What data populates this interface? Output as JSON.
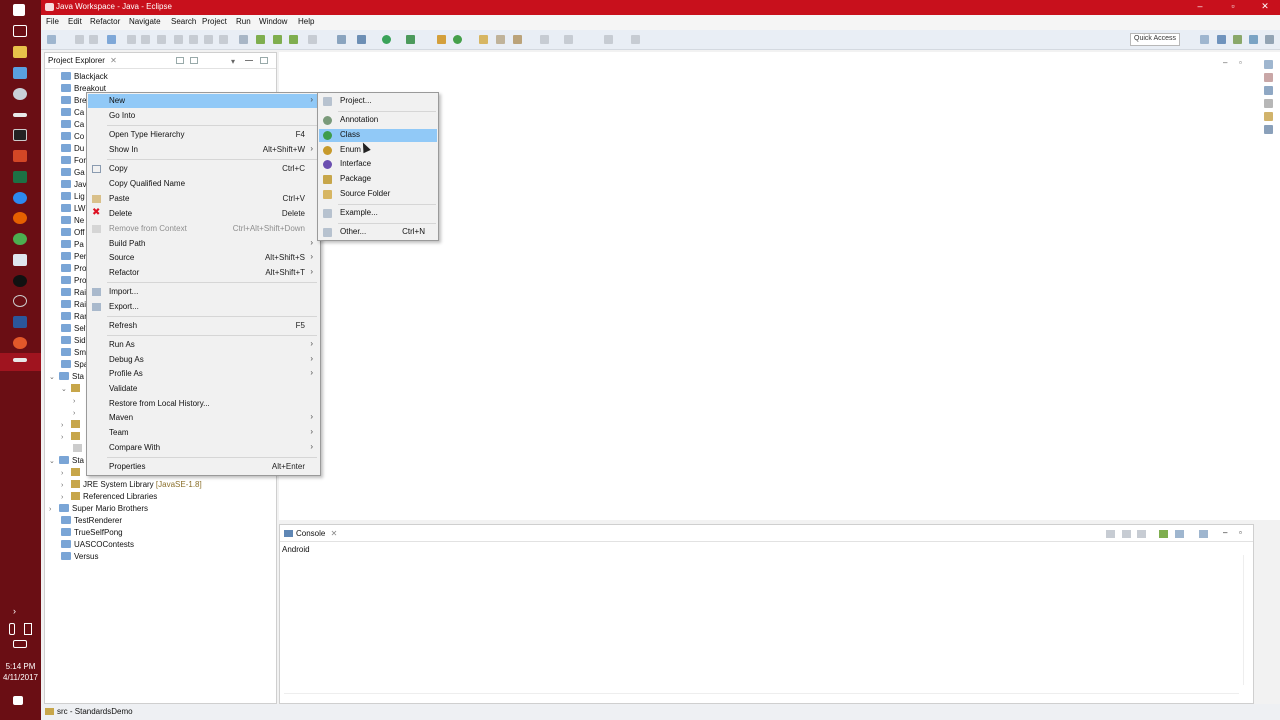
{
  "window": {
    "title": "Java Workspace - Java - Eclipse"
  },
  "menubar": [
    "File",
    "Edit",
    "Refactor",
    "Navigate",
    "Search",
    "Project",
    "Run",
    "Window",
    "Help"
  ],
  "toolbar": {
    "quick_access": "Quick Access"
  },
  "explorer": {
    "title": "Project Explorer",
    "rows": [
      "Blackjack",
      "Breakout",
      "Bre",
      "Ca",
      "Ca",
      "Co",
      "Du",
      "For",
      "Ga",
      "Jav",
      "Lig",
      "LW",
      "Ne",
      "Off",
      "Pa",
      "Per",
      "Pro",
      "Pro",
      "Rai",
      "Rai",
      "Ran",
      "Self",
      "Sid",
      "Sm",
      "Spa",
      "Sta",
      "",
      "",
      "",
      "",
      "",
      "Sta",
      "",
      "JRE System Library",
      "Referenced Libraries",
      "Super Mario Brothers",
      "TestRenderer",
      "TrueSelfPong",
      "UASCOContests",
      "Versus"
    ],
    "jre_suffix": "[JavaSE-1.8]"
  },
  "context_menu": {
    "items": [
      {
        "label": "New",
        "shortcut": "",
        "submenu": true
      },
      {
        "label": "Go Into",
        "shortcut": ""
      },
      {
        "label": "Open Type Hierarchy",
        "shortcut": "F4"
      },
      {
        "label": "Show In",
        "shortcut": "Alt+Shift+W",
        "submenu": true
      },
      {
        "label": "Copy",
        "shortcut": "Ctrl+C"
      },
      {
        "label": "Copy Qualified Name",
        "shortcut": ""
      },
      {
        "label": "Paste",
        "shortcut": "Ctrl+V"
      },
      {
        "label": "Delete",
        "shortcut": "Delete"
      },
      {
        "label": "Remove from Context",
        "shortcut": "Ctrl+Alt+Shift+Down"
      },
      {
        "label": "Build Path",
        "shortcut": "",
        "submenu": true
      },
      {
        "label": "Source",
        "shortcut": "Alt+Shift+S",
        "submenu": true
      },
      {
        "label": "Refactor",
        "shortcut": "Alt+Shift+T",
        "submenu": true
      },
      {
        "label": "Import...",
        "shortcut": ""
      },
      {
        "label": "Export...",
        "shortcut": ""
      },
      {
        "label": "Refresh",
        "shortcut": "F5"
      },
      {
        "label": "Run As",
        "shortcut": "",
        "submenu": true
      },
      {
        "label": "Debug As",
        "shortcut": "",
        "submenu": true
      },
      {
        "label": "Profile As",
        "shortcut": "",
        "submenu": true
      },
      {
        "label": "Validate",
        "shortcut": ""
      },
      {
        "label": "Restore from Local History...",
        "shortcut": ""
      },
      {
        "label": "Maven",
        "shortcut": "",
        "submenu": true
      },
      {
        "label": "Team",
        "shortcut": "",
        "submenu": true
      },
      {
        "label": "Compare With",
        "shortcut": "",
        "submenu": true
      },
      {
        "label": "Properties",
        "shortcut": "Alt+Enter"
      }
    ]
  },
  "new_submenu": {
    "items": [
      {
        "label": "Project...",
        "shortcut": ""
      },
      {
        "label": "Annotation",
        "shortcut": ""
      },
      {
        "label": "Class",
        "shortcut": ""
      },
      {
        "label": "Enum",
        "shortcut": ""
      },
      {
        "label": "Interface",
        "shortcut": ""
      },
      {
        "label": "Package",
        "shortcut": ""
      },
      {
        "label": "Source Folder",
        "shortcut": ""
      },
      {
        "label": "Example...",
        "shortcut": ""
      },
      {
        "label": "Other...",
        "shortcut": "Ctrl+N"
      }
    ]
  },
  "console": {
    "title": "Console",
    "content": "Android"
  },
  "statusbar": {
    "text": "src - StandardsDemo"
  },
  "taskbar": {
    "time": "5:14 PM",
    "date": "4/11/2017"
  },
  "colors": {
    "title_bar": "#c8101c",
    "taskbar": "#6a0e14",
    "menu_highlight": "#91c9f7"
  }
}
